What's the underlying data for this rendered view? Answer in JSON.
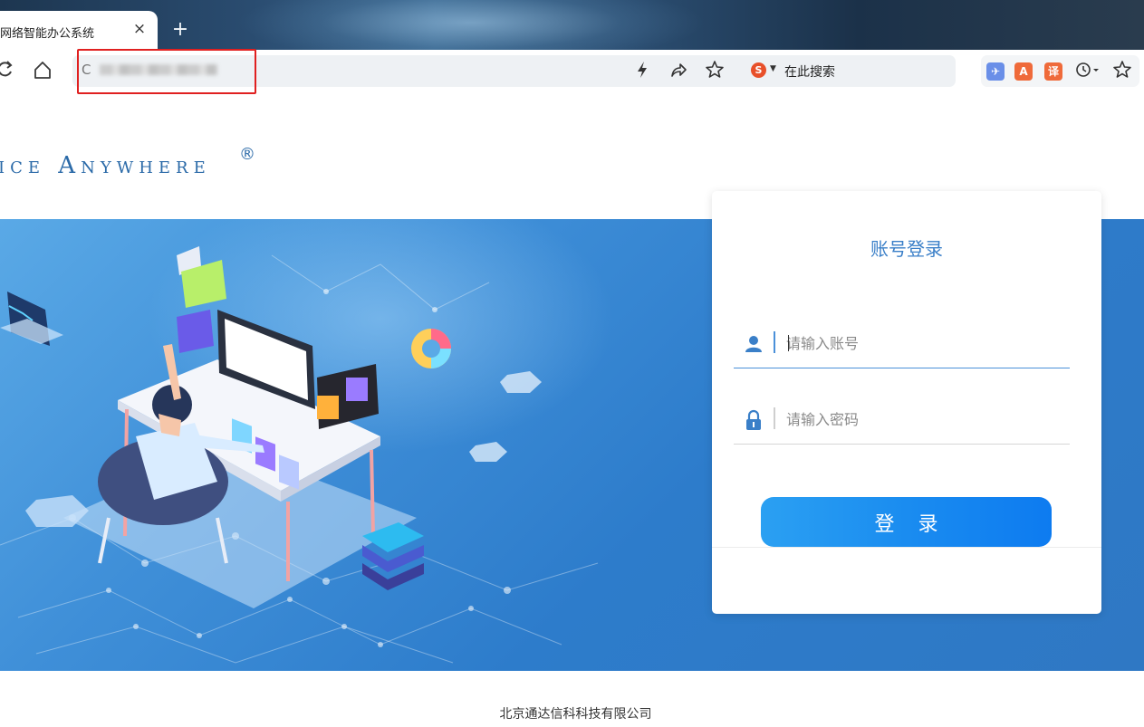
{
  "browser": {
    "tab": {
      "title": "网络智能办公系统",
      "close_glyph": "×"
    },
    "new_tab_glyph": "+",
    "address": {
      "lead_glyph": "C"
    },
    "search": {
      "engine_glyph": "S",
      "label": "在此搜索"
    },
    "extensions": [
      {
        "name": "bird-extension",
        "glyph": "✈",
        "color": "#6a8fe8"
      },
      {
        "name": "pdf-extension",
        "glyph": "A",
        "color": "#ef6a3a"
      },
      {
        "name": "translate-extension",
        "glyph": "译",
        "color": "#ef6a3a"
      }
    ]
  },
  "page": {
    "brand": "ice Anywhere",
    "brand_mark": "®",
    "login": {
      "title": "账号登录",
      "username_placeholder": "请输入账号",
      "password_placeholder": "请输入密码",
      "submit_label": "登录"
    },
    "footer": "北京通达信科科技有限公司"
  },
  "colors": {
    "accent": "#3a7fc8",
    "button": "#1a8cf0",
    "banner": "#2f78c4",
    "highlight": "#e02020"
  }
}
